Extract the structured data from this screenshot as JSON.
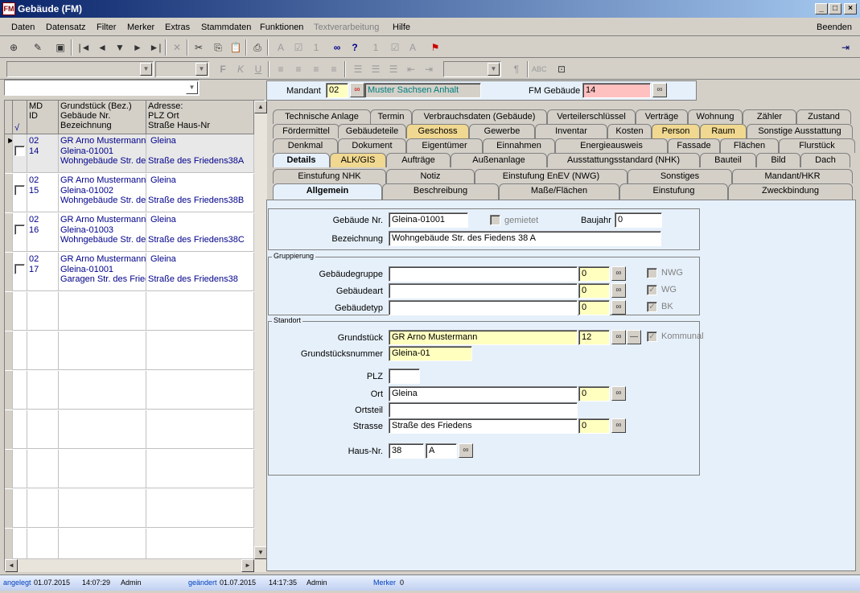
{
  "window": {
    "title": "Gebäude (FM)"
  },
  "menu": [
    "Daten",
    "Datensatz",
    "Filter",
    "Merker",
    "Extras",
    "Stammdaten",
    "Funktionen",
    "Textverarbeitung",
    "Hilfe"
  ],
  "menu_right": "Beenden",
  "mandant_bar": {
    "mandant_label": "Mandant",
    "mandant_value": "02",
    "mandant_name": "Muster Sachsen Anhalt",
    "fm_label": "FM Gebäude",
    "fm_value": "14"
  },
  "grid": {
    "headers": {
      "col1": "√",
      "col2a": "MD",
      "col2b": "ID",
      "col3a": "Grundstück (Bez.)",
      "col3b": "Gebäude Nr.",
      "col3c": "Bezeichnung",
      "col4a": "Adresse:",
      "col4b": "PLZ Ort",
      "col4c": "Straße Haus-Nr"
    },
    "rows": [
      {
        "md": "02",
        "id": "14",
        "l1": "GR Arno Mustermann",
        "l2": "Gleina-01001",
        "l3": "Wohngebäude Str. des",
        "a1": "Gleina",
        "a3": "Straße des Friedens38A"
      },
      {
        "md": "02",
        "id": "15",
        "l1": "GR Arno Mustermann",
        "l2": "Gleina-01002",
        "l3": "Wohngebäude Str. des",
        "a1": "Gleina",
        "a3": "Straße des Friedens38B"
      },
      {
        "md": "02",
        "id": "16",
        "l1": "GR Arno Mustermann",
        "l2": "Gleina-01003",
        "l3": "Wohngebäude Str. des",
        "a1": "Gleina",
        "a3": "Straße des Friedens38C"
      },
      {
        "md": "02",
        "id": "17",
        "l1": "GR Arno Mustermann",
        "l2": "Gleina-01001",
        "l3": "Garagen Str. des Fried",
        "a1": "Gleina",
        "a3": "Straße des Friedens38"
      }
    ]
  },
  "tabs": {
    "row1": [
      "Technische Anlage",
      "Termin",
      "Verbrauchsdaten (Gebäude)",
      "Verteilerschlüssel",
      "Verträge",
      "Wohnung",
      "Zähler",
      "Zustand"
    ],
    "row2": [
      "Fördermittel",
      "Gebäudeteile",
      "Geschoss",
      "Gewerbe",
      "Inventar",
      "Kosten",
      "Person",
      "Raum",
      "Sonstige Ausstattung"
    ],
    "row3": [
      "Denkmal",
      "Dokument",
      "Eigentümer",
      "Einnahmen",
      "Energieausweis",
      "Fassade",
      "Flächen",
      "Flurstück"
    ],
    "row4": [
      "Details",
      "ALK/GIS",
      "Aufträge",
      "Außenanlage",
      "Ausstattungsstandard (NHK)",
      "Bauteil",
      "Bild",
      "Dach"
    ],
    "row5": [
      "Einstufung NHK",
      "Notiz",
      "Einstufung EnEV (NWG)",
      "Sonstiges",
      "Mandant/HKR"
    ],
    "row6": [
      "Allgemein",
      "Beschreibung",
      "Maße/Flächen",
      "Einstufung",
      "Zweckbindung"
    ]
  },
  "form": {
    "gebaeude_nr_label": "Gebäude Nr.",
    "gebaeude_nr": "Gleina-01001",
    "gemietet_label": "gemietet",
    "baujahr_label": "Baujahr",
    "baujahr": "0",
    "bezeichnung_label": "Bezeichnung",
    "bezeichnung": "Wohngebäude Str. des Fiedens 38 A",
    "gruppierung_title": "Gruppierung",
    "gebaeudegruppe_label": "Gebäudegruppe",
    "gebaeudegruppe_num": "0",
    "gebaeudeart_label": "Gebäudeart",
    "gebaeudeart_num": "0",
    "gebaeudetyp_label": "Gebäudetyp",
    "gebaeudetyp_num": "0",
    "nwg_label": "NWG",
    "wg_label": "WG",
    "bk_label": "BK",
    "standort_title": "Standort",
    "grundstueck_label": "Grundstück",
    "grundstueck": "GR Arno Mustermann",
    "grundstueck_num": "12",
    "kommunal_label": "Kommunal",
    "grundstuecksnummer_label": "Grundstücksnummer",
    "grundstuecksnummer": "Gleina-01",
    "plz_label": "PLZ",
    "plz": "",
    "ort_label": "Ort",
    "ort": "Gleina",
    "ort_num": "0",
    "ortsteil_label": "Ortsteil",
    "ortsteil": "",
    "strasse_label": "Strasse",
    "strasse": "Straße des Friedens",
    "strasse_num": "0",
    "hausnr_label": "Haus-Nr.",
    "hausnr": "38",
    "hausnr_zusatz": "A"
  },
  "status": {
    "angelegt_label": "angelegt",
    "angelegt_date": "01.07.2015",
    "angelegt_time": "14:07:29",
    "angelegt_user": "Admin",
    "geaendert_label": "geändert",
    "geaendert_date": "01.07.2015",
    "geaendert_time": "14:17:35",
    "geaendert_user": "Admin",
    "merker_label": "Merker",
    "merker_value": "0"
  }
}
